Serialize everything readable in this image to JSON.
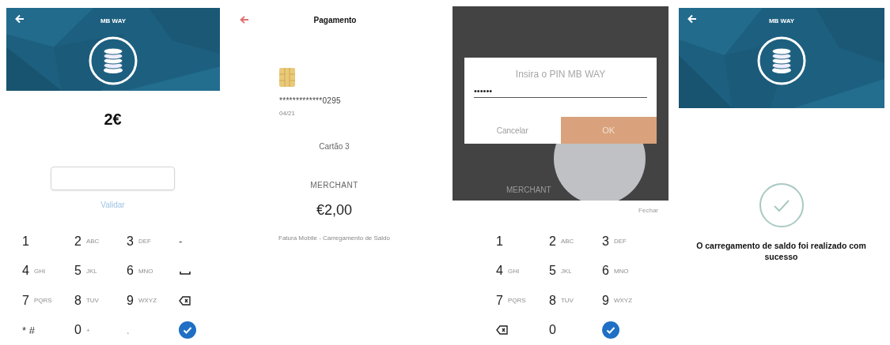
{
  "screens": [
    {
      "kind": "amount",
      "header": {
        "title": "MB WAY"
      },
      "amount": "2€",
      "validate_link": "Validar",
      "keypad": [
        {
          "kind": "digit",
          "label": "1"
        },
        {
          "kind": "digit",
          "label": "2",
          "letters": "ABC"
        },
        {
          "kind": "digit",
          "label": "3",
          "letters": "DEF"
        },
        {
          "kind": "symbol",
          "label": "-"
        },
        {
          "kind": "digit",
          "label": "4",
          "letters": "GHI"
        },
        {
          "kind": "digit",
          "label": "5",
          "letters": "JKL"
        },
        {
          "kind": "digit",
          "label": "6",
          "letters": "MNO"
        },
        {
          "kind": "space"
        },
        {
          "kind": "digit",
          "label": "7",
          "letters": "PQRS"
        },
        {
          "kind": "digit",
          "label": "8",
          "letters": "TUV"
        },
        {
          "kind": "digit",
          "label": "9",
          "letters": "WXYZ"
        },
        {
          "kind": "backspace"
        },
        {
          "kind": "symbol",
          "label": "* #"
        },
        {
          "kind": "digit",
          "label": "0",
          "letters": "+"
        },
        {
          "kind": "faint",
          "label": "."
        },
        {
          "kind": "confirm"
        }
      ]
    },
    {
      "kind": "payment",
      "title": "Pagamento",
      "card": {
        "number": "*************0295",
        "expiry": "04/21"
      },
      "card_name": "Cartão 3",
      "merchant": "MERCHANT",
      "amount": "€2,00",
      "description": "Fatura Mobile - Carregamento de Saldo"
    },
    {
      "kind": "pin",
      "dialog": {
        "title": "Insira o PIN MB WAY",
        "pin": "••••••",
        "cancel": "Cancelar",
        "ok": "OK"
      },
      "background_label": "MERCHANT",
      "close_link": "Fechar",
      "keypad": [
        {
          "kind": "digit",
          "label": "1"
        },
        {
          "kind": "digit",
          "label": "2",
          "letters": "ABC"
        },
        {
          "kind": "digit",
          "label": "3",
          "letters": "DEF"
        },
        {
          "kind": "digit",
          "label": "4",
          "letters": "GHI"
        },
        {
          "kind": "digit",
          "label": "5",
          "letters": "JKL"
        },
        {
          "kind": "digit",
          "label": "6",
          "letters": "MNO"
        },
        {
          "kind": "digit",
          "label": "7",
          "letters": "PQRS"
        },
        {
          "kind": "digit",
          "label": "8",
          "letters": "TUV"
        },
        {
          "kind": "digit",
          "label": "9",
          "letters": "WXYZ"
        },
        {
          "kind": "backspace"
        },
        {
          "kind": "digit",
          "label": "0"
        },
        {
          "kind": "confirm"
        }
      ]
    },
    {
      "kind": "success",
      "header": {
        "title": "MB WAY"
      },
      "message": "O carregamento de saldo foi realizado com sucesso"
    }
  ]
}
